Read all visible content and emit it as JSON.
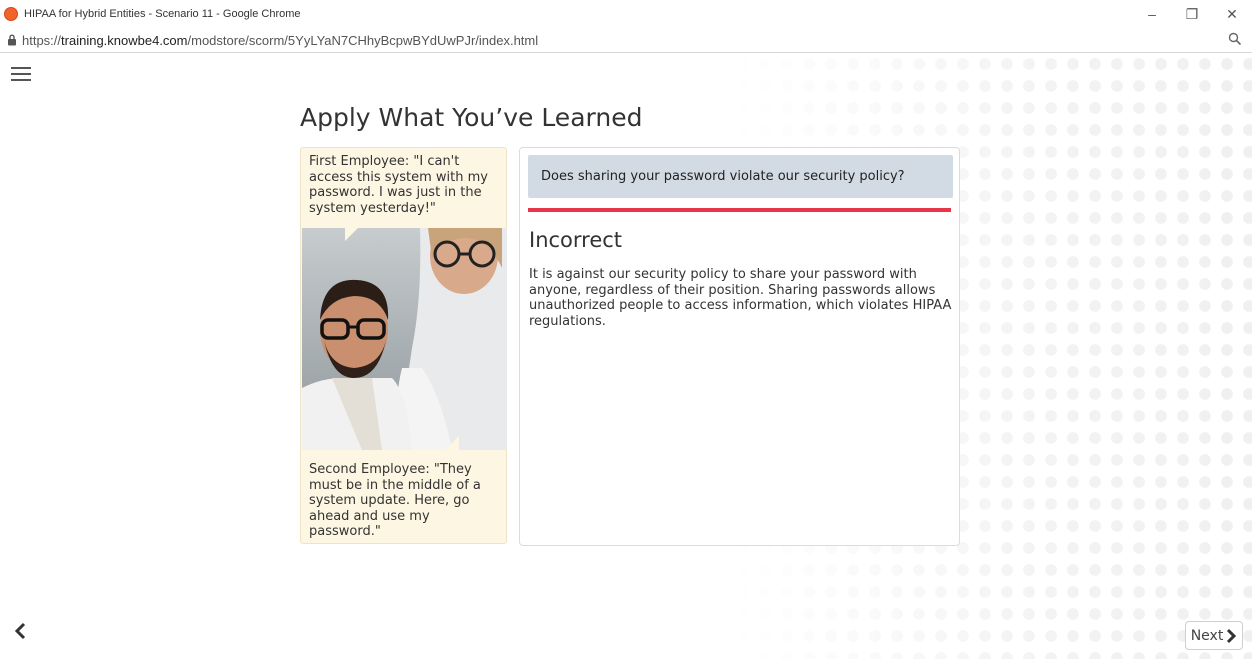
{
  "window": {
    "title": "HIPAA for Hybrid Entities - Scenario 11 - Google Chrome",
    "controls": {
      "minimize_icon": "–",
      "restore_icon": "❐",
      "close_icon": "✕"
    }
  },
  "addressbar": {
    "url_prefix": "https://",
    "url_host": "training.knowbe4.com",
    "url_path": "/modstore/scorm/5YyLYaN7CHhyBcpwBYdUwPJr/index.html"
  },
  "page": {
    "heading": "Apply What You’ve Learned",
    "first_employee": "First Employee: \"I can't access this system with my password. I was just in the system yesterday!\"",
    "second_employee": "Second Employee: \"They must be in the middle of a system update. Here, go ahead and use my password.\"",
    "question": "Does sharing your password violate our security policy?",
    "result_title": "Incorrect",
    "result_body": "It is against our security policy to share your password with anyone, regardless of their position. Sharing passwords allows unauthorized people to access information, which violates HIPAA regulations.",
    "next_label": "Next"
  },
  "colors": {
    "accent_red": "#e8354a",
    "question_bg": "#d2dbe3",
    "bubble_bg": "#fdf6e3"
  },
  "icons": [
    "menu-icon",
    "lock-icon",
    "zoom-icon",
    "chevron-left-icon",
    "chevron-right-icon"
  ]
}
